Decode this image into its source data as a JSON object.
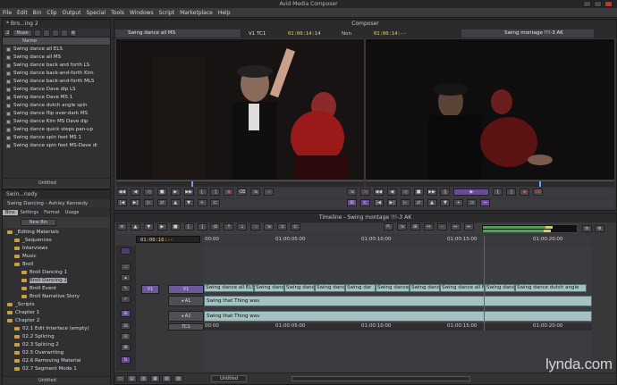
{
  "app": {
    "title": "Avid Media Composer",
    "menu": [
      "File",
      "Edit",
      "Bin",
      "Clip",
      "Output",
      "Special",
      "Tools",
      "Windows",
      "Script",
      "Marketplace",
      "Help"
    ]
  },
  "bin": {
    "title": "* Bro...ing 2",
    "tab": "Muse",
    "column_header": "Name",
    "items": [
      "Swing dance all ELS",
      "Swing dance all MS",
      "Swing dance back and forth LS",
      "Swing dance back-and-forth Kim",
      "Swing dance back-and-forth MLS",
      "Swing dance Dave dip LS",
      "Swing dance Dave MS 1",
      "Swing dance dutch angle spin",
      "Swing dance flip over-dark MS",
      "Swing dance Kim MS Dave dip",
      "Swing dance quick steps pan-up",
      "Swing dance spin feet MS 1",
      "Swing dance spin feet MS-Dave di"
    ],
    "footer": "Untitled"
  },
  "project": {
    "title": "Swin...nedy",
    "name": "Swing Dancing - Ashley Kennedy",
    "tabs": [
      "Bins",
      "Settings",
      "Format",
      "Usage"
    ],
    "new_bin": "New Bin",
    "tree": [
      {
        "label": "_Editing Materials",
        "level": 0,
        "selected": false
      },
      {
        "label": "_Sequences",
        "level": 1,
        "selected": false
      },
      {
        "label": "Interviews",
        "level": 1,
        "selected": false
      },
      {
        "label": "Music",
        "level": 1,
        "selected": false
      },
      {
        "label": "Broll",
        "level": 1,
        "selected": false
      },
      {
        "label": "Broll Dancing 1",
        "level": 2,
        "selected": false
      },
      {
        "label": "Broll Dancing 2",
        "level": 2,
        "selected": true
      },
      {
        "label": "Broll Event",
        "level": 2,
        "selected": false
      },
      {
        "label": "Broll Narrative Story",
        "level": 2,
        "selected": false
      },
      {
        "label": "_Scripts",
        "level": 0,
        "selected": false
      },
      {
        "label": "Chapter 1",
        "level": 0,
        "selected": false
      },
      {
        "label": "Chapter 2",
        "level": 0,
        "selected": false
      },
      {
        "label": "02.1 Edit Interface (empty)",
        "level": 1,
        "selected": false
      },
      {
        "label": "02.2 Splicing",
        "level": 1,
        "selected": false
      },
      {
        "label": "02.3 Splicing 2",
        "level": 1,
        "selected": false
      },
      {
        "label": "02.5 Overwriting",
        "level": 1,
        "selected": false
      },
      {
        "label": "02.6 Removing Material",
        "level": 1,
        "selected": false
      },
      {
        "label": "02.7 Segment Mode 1",
        "level": 1,
        "selected": false
      }
    ],
    "footer": "Untitled"
  },
  "composer": {
    "title": "Composer",
    "source_clip": "Swing dance all MS",
    "source_track": "V1 TC1",
    "source_tc": "01:00:14:14",
    "mode_label": "Non",
    "record_tc": "01:00:14:--",
    "record_seq": "Swing montage !!!-3 AK"
  },
  "timeline": {
    "title": "Timeline - Swing montage !!!-3 AK",
    "current_tc": "01:00:16:--",
    "ruler_top": [
      "00:00",
      "01:00:05:00",
      "01:00:10:00",
      "01:00:15:00",
      "01:00:20:00"
    ],
    "ruler_bottom": [
      "00:00",
      "01:00:05:00",
      "01:00:10:00",
      "01:00:15:00",
      "01:00:20:00"
    ],
    "tracks": {
      "v1": "V1",
      "a1": "A1",
      "a2": "A2",
      "tc1": "TC1",
      "src": "V1"
    },
    "video_clips": [
      "Swing dance all ELS",
      "Swing danc",
      "Swing danc",
      "Swing danc",
      "Swing dar",
      "Swing dance all",
      "Swing danc",
      "Swing dance all M",
      "Swing danc",
      "Swing dance dutch angle"
    ],
    "audio1": "Swing that Thing wav",
    "audio2": "Swing that Thing wav",
    "footer": "Untitled"
  },
  "watermark": "lynda.com"
}
